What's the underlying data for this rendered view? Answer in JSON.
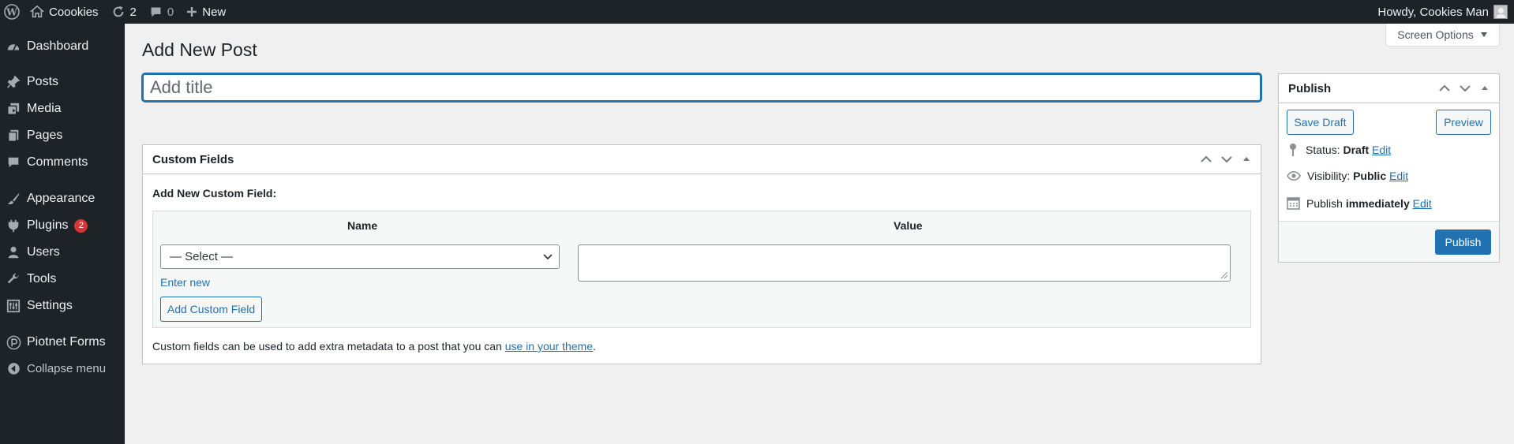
{
  "adminbar": {
    "site_name": "Coookies",
    "updates_count": "2",
    "comments_count": "0",
    "new_label": "New",
    "greeting": "Howdy, Cookies Man"
  },
  "sidebar": {
    "items": [
      {
        "label": "Dashboard",
        "icon": "dashboard-icon"
      },
      {
        "label": "Posts",
        "icon": "pushpin-icon"
      },
      {
        "label": "Media",
        "icon": "media-icon"
      },
      {
        "label": "Pages",
        "icon": "pages-icon"
      },
      {
        "label": "Comments",
        "icon": "comment-icon"
      },
      {
        "label": "Appearance",
        "icon": "brush-icon"
      },
      {
        "label": "Plugins",
        "icon": "plugin-icon",
        "badge": "2"
      },
      {
        "label": "Users",
        "icon": "user-icon"
      },
      {
        "label": "Tools",
        "icon": "wrench-icon"
      },
      {
        "label": "Settings",
        "icon": "settings-icon"
      },
      {
        "label": "Piotnet Forms",
        "icon": "piotnet-icon"
      }
    ],
    "collapse_label": "Collapse menu"
  },
  "main": {
    "screen_options": "Screen Options",
    "page_title": "Add New Post",
    "title_placeholder": "Add title",
    "title_value": ""
  },
  "custom_fields": {
    "title": "Custom Fields",
    "subheading": "Add New Custom Field:",
    "col_name": "Name",
    "col_value": "Value",
    "select_value": "— Select —",
    "enter_new": "Enter new",
    "add_button": "Add Custom Field",
    "note_text": "Custom fields can be used to add extra metadata to a post that you can ",
    "note_link": "use in your theme",
    "note_end": "."
  },
  "publish": {
    "title": "Publish",
    "save_draft": "Save Draft",
    "preview": "Preview",
    "status_label": "Status: ",
    "status_value": "Draft",
    "visibility_label": "Visibility: ",
    "visibility_value": "Public",
    "publish_label": "Publish ",
    "publish_value": "immediately",
    "edit": "Edit",
    "publish_button": "Publish"
  },
  "colors": {
    "accent": "#2271b1",
    "adminbar_bg": "#1d2327",
    "badge": "#d63638"
  }
}
